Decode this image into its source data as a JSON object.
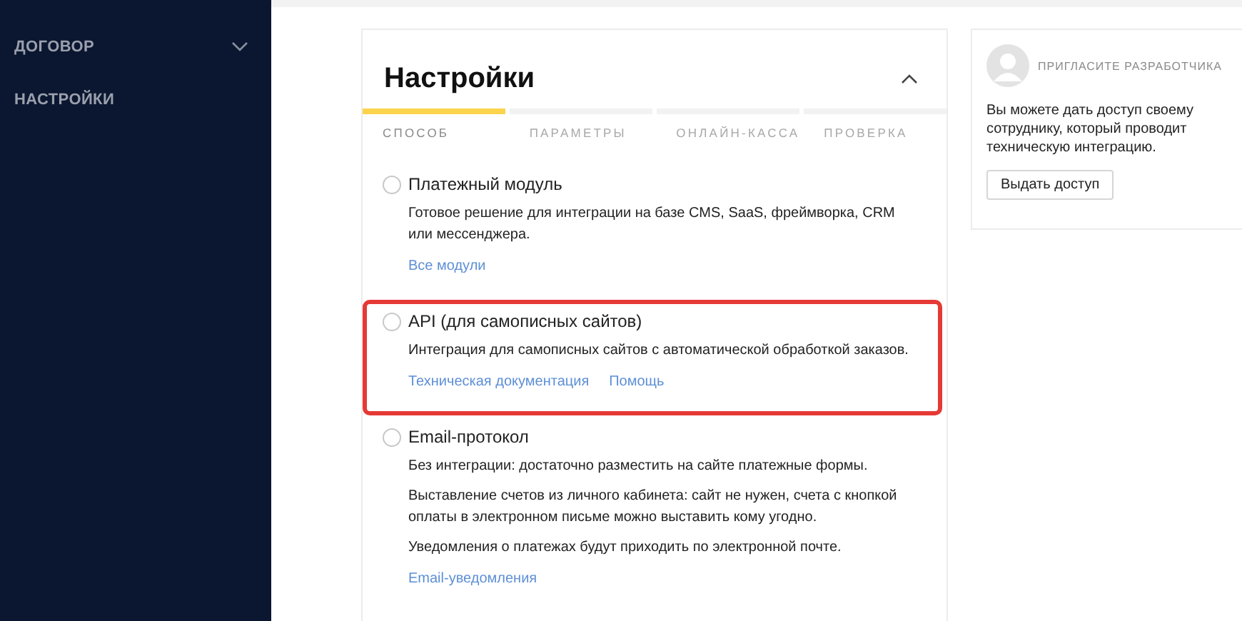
{
  "sidebar": {
    "items": [
      {
        "label": "ДОГОВОР",
        "kind": "group"
      },
      {
        "label": "НАСТРОЙКИ",
        "kind": "link"
      }
    ]
  },
  "settings": {
    "title": "Настройки",
    "steps": [
      {
        "label": "СПОСОБ",
        "selected": true
      },
      {
        "label": "ПАРАМЕТРЫ",
        "selected": false
      },
      {
        "label": "ОНЛАЙН-КАССА",
        "selected": false
      },
      {
        "label": "ПРОВЕРКА",
        "selected": false
      }
    ],
    "options": [
      {
        "title": "Платежный модуль",
        "checked": false,
        "highlighted": false,
        "paragraphs": [
          "Готовое решение для интеграции на базе CMS, SaaS, фреймворка, CRM или мессенджера."
        ],
        "links": [
          "Все модули"
        ]
      },
      {
        "title": "API (для самописных сайтов)",
        "checked": false,
        "highlighted": true,
        "paragraphs": [
          "Интеграция для самописных сайтов с автоматической обработкой заказов."
        ],
        "links": [
          "Техническая документация",
          "Помощь"
        ]
      },
      {
        "title": "Email-протокол",
        "checked": false,
        "highlighted": false,
        "paragraphs": [
          "Без интеграции: достаточно разместить на сайте платежные формы.",
          "Выставление счетов из личного кабинета: сайт не нужен, счета с кнопкой оплаты в электронном письме можно выставить кому угодно.",
          "Уведомления о платежах будут приходить по электронной почте."
        ],
        "links": [
          "Email-уведомления"
        ]
      }
    ]
  },
  "invite": {
    "title": "ПРИГЛАСИТЕ РАЗРАБОТЧИКА",
    "text": "Вы можете дать доступ своему сотруднику, который проводит техническую интеграцию.",
    "button": "Выдать доступ"
  }
}
